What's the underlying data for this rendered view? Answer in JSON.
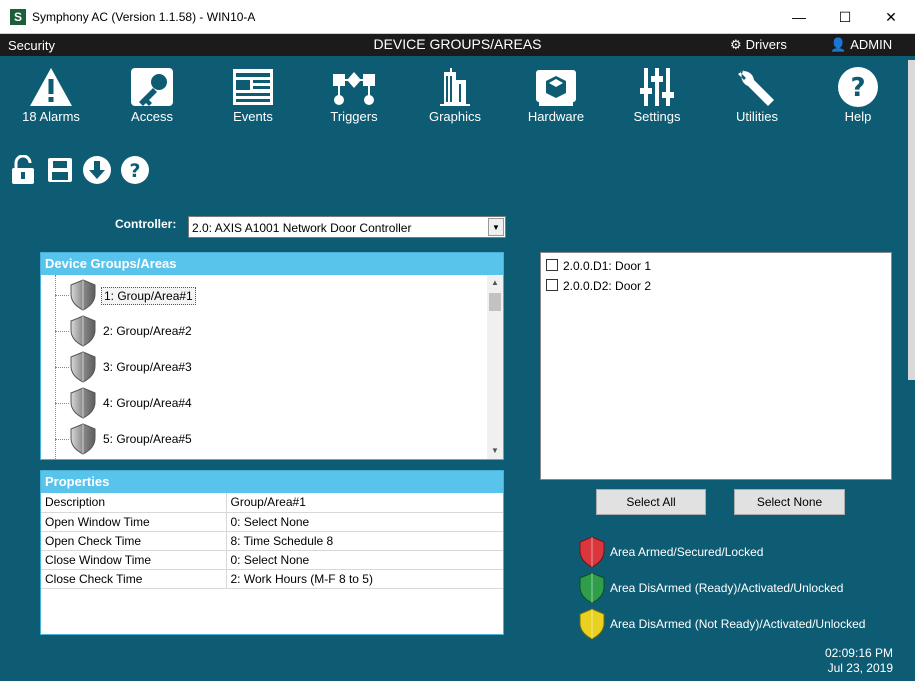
{
  "window": {
    "title": "Symphony AC  (Version 1.1.58) - WIN10-A",
    "logo": "S"
  },
  "header": {
    "section": "Security",
    "page_title": "DEVICE GROUPS/AREAS",
    "drivers": "Drivers",
    "user": "ADMIN"
  },
  "nav": [
    {
      "label": "18 Alarms",
      "icon": "warning-icon"
    },
    {
      "label": "Access",
      "icon": "key-icon"
    },
    {
      "label": "Events",
      "icon": "event-list-icon"
    },
    {
      "label": "Triggers",
      "icon": "trigger-icon"
    },
    {
      "label": "Graphics",
      "icon": "building-icon"
    },
    {
      "label": "Hardware",
      "icon": "hardware-icon"
    },
    {
      "label": "Settings",
      "icon": "sliders-icon"
    },
    {
      "label": "Utilities",
      "icon": "wrench-icon"
    },
    {
      "label": "Help",
      "icon": "help-icon"
    }
  ],
  "controller": {
    "label": "Controller:",
    "value": "2.0: AXIS A1001 Network Door Controller"
  },
  "device_groups": {
    "header": "Device Groups/Areas",
    "items": [
      "1:  Group/Area#1",
      "2:  Group/Area#2",
      "3:  Group/Area#3",
      "4:  Group/Area#4",
      "5:  Group/Area#5"
    ]
  },
  "properties": {
    "header": "Properties",
    "rows": [
      {
        "key": "Description",
        "value": "Group/Area#1"
      },
      {
        "key": "Open Window Time",
        "value": "0:  Select None"
      },
      {
        "key": "Open Check Time",
        "value": "8:  Time Schedule 8"
      },
      {
        "key": "Close Window Time",
        "value": "0:  Select None"
      },
      {
        "key": "Close Check Time",
        "value": "2:  Work Hours (M-F 8 to 5)"
      }
    ]
  },
  "doors": [
    "2.0.0.D1:  Door 1",
    "2.0.0.D2:  Door 2"
  ],
  "buttons": {
    "select_all": "Select All",
    "select_none": "Select None"
  },
  "legend": [
    {
      "text": "Area Armed/Secured/Locked",
      "color": "#d9363e"
    },
    {
      "text": "Area DisArmed (Ready)/Activated/Unlocked",
      "color": "#2e9e4a"
    },
    {
      "text": "Area DisArmed (Not Ready)/Activated/Unlocked",
      "color": "#e8d21f"
    }
  ],
  "clock": {
    "time": "02:09:16 PM",
    "date": "Jul 23, 2019"
  }
}
